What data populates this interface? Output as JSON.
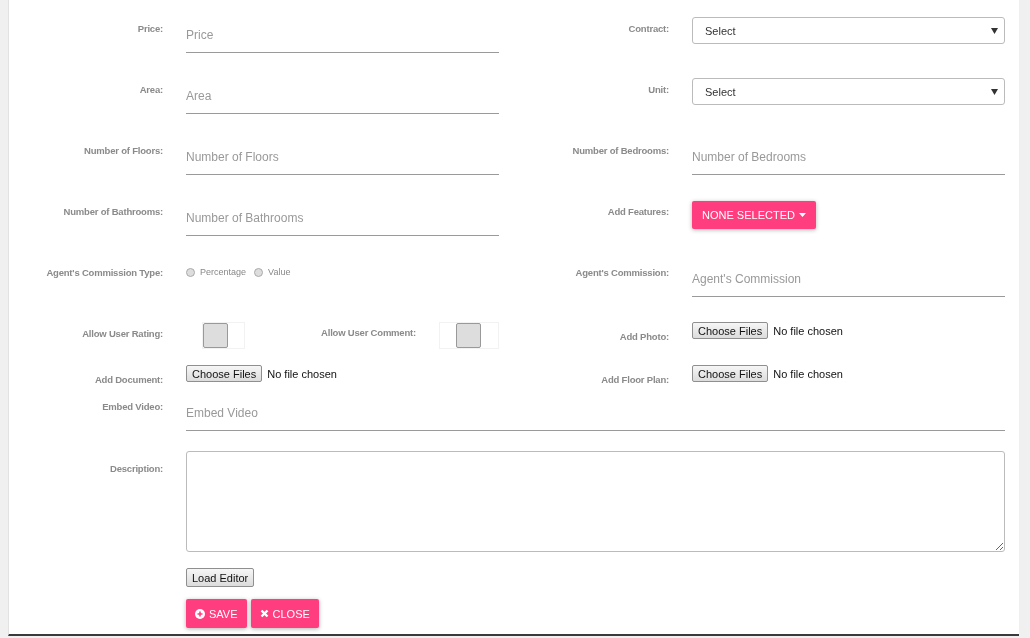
{
  "form": {
    "rows": [
      {
        "cells": [
          {
            "kind": "text",
            "label": "Price:",
            "placeholder": "Price"
          },
          {
            "kind": "select",
            "label": "Contract:",
            "value": "Select"
          }
        ]
      },
      {
        "cells": [
          {
            "kind": "text",
            "label": "Area:",
            "placeholder": "Area"
          },
          {
            "kind": "select",
            "label": "Unit:",
            "value": "Select"
          }
        ]
      },
      {
        "cells": [
          {
            "kind": "text",
            "label": "Number of Floors:",
            "placeholder": "Number of Floors"
          },
          {
            "kind": "text",
            "label": "Number of Bedrooms:",
            "placeholder": "Number of Bedrooms"
          }
        ]
      },
      {
        "cells": [
          {
            "kind": "text",
            "label": "Number of Bathrooms:",
            "placeholder": "Number of Bathrooms"
          },
          {
            "kind": "dropdown",
            "label": "Add Features:",
            "value": "NONE SELECTED"
          }
        ]
      },
      {
        "cells": [
          {
            "kind": "radio",
            "label": "Agent's Commission Type:",
            "options": [
              {
                "label": "Percentage",
                "selected": false
              },
              {
                "label": "Value",
                "selected": false
              }
            ]
          },
          {
            "kind": "text",
            "label": "Agent's Commission:",
            "placeholder": "Agent's Commission"
          }
        ]
      },
      {
        "cells": [
          {
            "kind": "toggles",
            "items": [
              {
                "label": "Allow User Rating:",
                "on": false
              },
              {
                "label": "Allow User Comment:",
                "on": false
              }
            ]
          },
          {
            "kind": "file",
            "label": "Add Photo:",
            "button": "Choose Files",
            "status": "No file chosen"
          }
        ]
      },
      {
        "cells": [
          {
            "kind": "file",
            "label": "Add Document:",
            "button": "Choose Files",
            "status": "No file chosen"
          },
          {
            "kind": "file",
            "label": "Add Floor Plan:",
            "button": "Choose Files",
            "status": "No file chosen"
          }
        ]
      }
    ],
    "embed": {
      "label": "Embed Video:",
      "placeholder": "Embed Video"
    },
    "description": {
      "label": "Description:"
    },
    "load_editor": "Load Editor",
    "actions": [
      {
        "kind": "save",
        "label": "SAVE"
      },
      {
        "kind": "close",
        "label": "CLOSE"
      }
    ]
  }
}
